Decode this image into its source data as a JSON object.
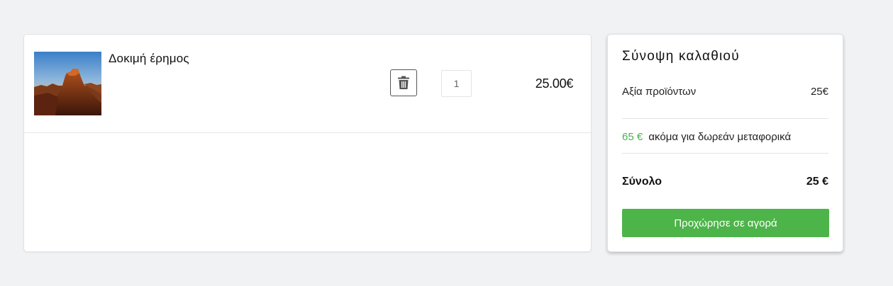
{
  "cart": {
    "items": [
      {
        "name": "Δοκιμή έρημος",
        "quantity": "1",
        "price": "25.00€",
        "image_icon": "desert-photo"
      }
    ]
  },
  "summary": {
    "title": "Σύνοψη καλαθιού",
    "subtotal_label": "Αξία προϊόντων",
    "subtotal_value": "25€",
    "free_shipping_amount": "65 €",
    "free_shipping_text": "ακόμα για δωρεάν μεταφορικά",
    "total_label": "Σύνολο",
    "total_value": "25 €",
    "checkout_label": "Προχώρησε σε αγορά"
  },
  "colors": {
    "accent_green": "#4db449",
    "shipping_green": "#4caf50",
    "background": "#f1f2f4"
  }
}
